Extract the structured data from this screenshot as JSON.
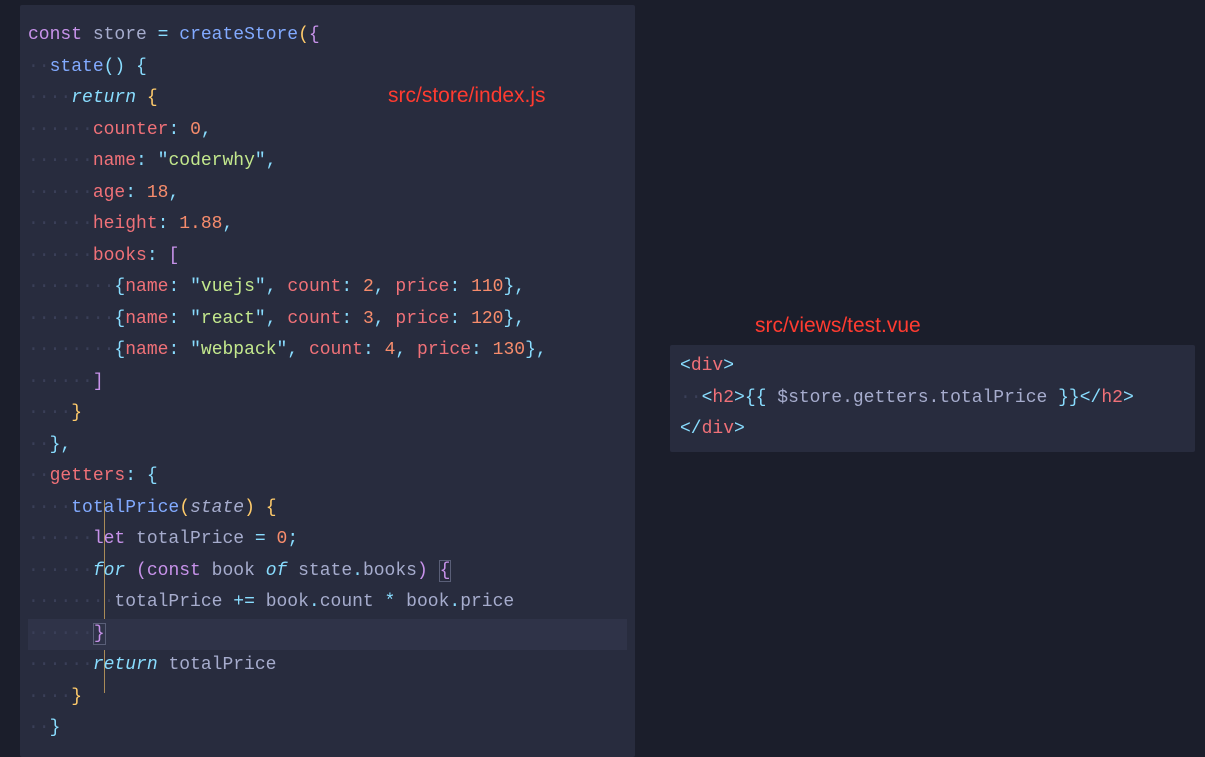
{
  "labels": {
    "left": "src/store/index.js",
    "right": "src/views/test.vue"
  },
  "leftCode": {
    "l1": {
      "kw": "const",
      "var": "store",
      "eq": "=",
      "fn": "createStore",
      "p1": "(",
      "p2": "{"
    },
    "l2": {
      "ws": "··",
      "fn": "state",
      "p1": "()",
      "sp": " ",
      "p2": "{"
    },
    "l3": {
      "ws": "····",
      "kw": "return",
      "sp": " ",
      "p": "{"
    },
    "l4": {
      "ws": "······",
      "prop": "counter",
      "c": ":",
      "sp": " ",
      "val": "0",
      "cm": ","
    },
    "l5": {
      "ws": "······",
      "prop": "name",
      "c": ":",
      "sp": " ",
      "q1": "\"",
      "val": "coderwhy",
      "q2": "\"",
      "cm": ","
    },
    "l6": {
      "ws": "······",
      "prop": "age",
      "c": ":",
      "sp": " ",
      "val": "18",
      "cm": ","
    },
    "l7": {
      "ws": "······",
      "prop": "height",
      "c": ":",
      "sp": " ",
      "val": "1.88",
      "cm": ","
    },
    "l8": {
      "ws": "······",
      "prop": "books",
      "c": ":",
      "sp": " ",
      "p": "["
    },
    "l9": {
      "ws": "········",
      "o": "{",
      "p1": "name",
      "c1": ":",
      "q1": "\"",
      "v1": "vuejs",
      "q2": "\"",
      "cm1": ",",
      "p2": "count",
      "c2": ":",
      "v2": "2",
      "cm2": ",",
      "p3": "price",
      "c3": ":",
      "v3": "110",
      "cl": "}",
      "cm3": ","
    },
    "l10": {
      "ws": "········",
      "o": "{",
      "p1": "name",
      "c1": ":",
      "q1": "\"",
      "v1": "react",
      "q2": "\"",
      "cm1": ",",
      "p2": "count",
      "c2": ":",
      "v2": "3",
      "cm2": ",",
      "p3": "price",
      "c3": ":",
      "v3": "120",
      "cl": "}",
      "cm3": ","
    },
    "l11": {
      "ws": "········",
      "o": "{",
      "p1": "name",
      "c1": ":",
      "q1": "\"",
      "v1": "webpack",
      "q2": "\"",
      "cm1": ",",
      "p2": "count",
      "c2": ":",
      "v2": "4",
      "cm2": ",",
      "p3": "price",
      "c3": ":",
      "v3": "130",
      "cl": "}",
      "cm3": ","
    },
    "l12": {
      "ws": "······",
      "p": "]"
    },
    "l13": {
      "ws": "····",
      "p": "}"
    },
    "l14": {
      "ws": "··",
      "p": "}",
      "cm": ","
    },
    "l15": {
      "ws": "··",
      "prop": "getters",
      "c": ":",
      "sp": " ",
      "p": "{"
    },
    "l16": {
      "ws": "····",
      "fn": "totalPrice",
      "p1": "(",
      "param": "state",
      "p2": ")",
      "sp": " ",
      "p3": "{"
    },
    "l17": {
      "ws": "······",
      "kw": "let",
      "var": "totalPrice",
      "eq": "=",
      "val": "0",
      "sc": ";"
    },
    "l18": {
      "ws": "······",
      "kw": "for",
      "p1": "(",
      "kw2": "const",
      "var": "book",
      "of": "of",
      "obj": "state",
      "dot": ".",
      "prop": "books",
      "p2": ")",
      "sp": " ",
      "p3": "{"
    },
    "l19": {
      "ws": "········",
      "var": "totalPrice",
      "op": "+=",
      "o1": "book",
      "d1": ".",
      "p1": "count",
      "mul": "*",
      "o2": "book",
      "d2": ".",
      "p2": "price"
    },
    "l20": {
      "ws": "······",
      "p": "}"
    },
    "l21": {
      "ws": "······",
      "kw": "return",
      "var": "totalPrice"
    },
    "l22": {
      "ws": "····",
      "p": "}"
    },
    "l23": {
      "ws": "··",
      "p": "}"
    }
  },
  "rightCode": {
    "l1": {
      "o": "<",
      "tag": "div",
      "c": ">"
    },
    "l2": {
      "ws": "··",
      "o": "<",
      "tag": "h2",
      "c": ">",
      "m1": "{{",
      "expr": "$store.getters.totalPrice",
      "m2": "}}",
      "co": "</",
      "ctag": "h2",
      "cc": ">"
    },
    "l3": {
      "o": "</",
      "tag": "div",
      "c": ">"
    }
  }
}
